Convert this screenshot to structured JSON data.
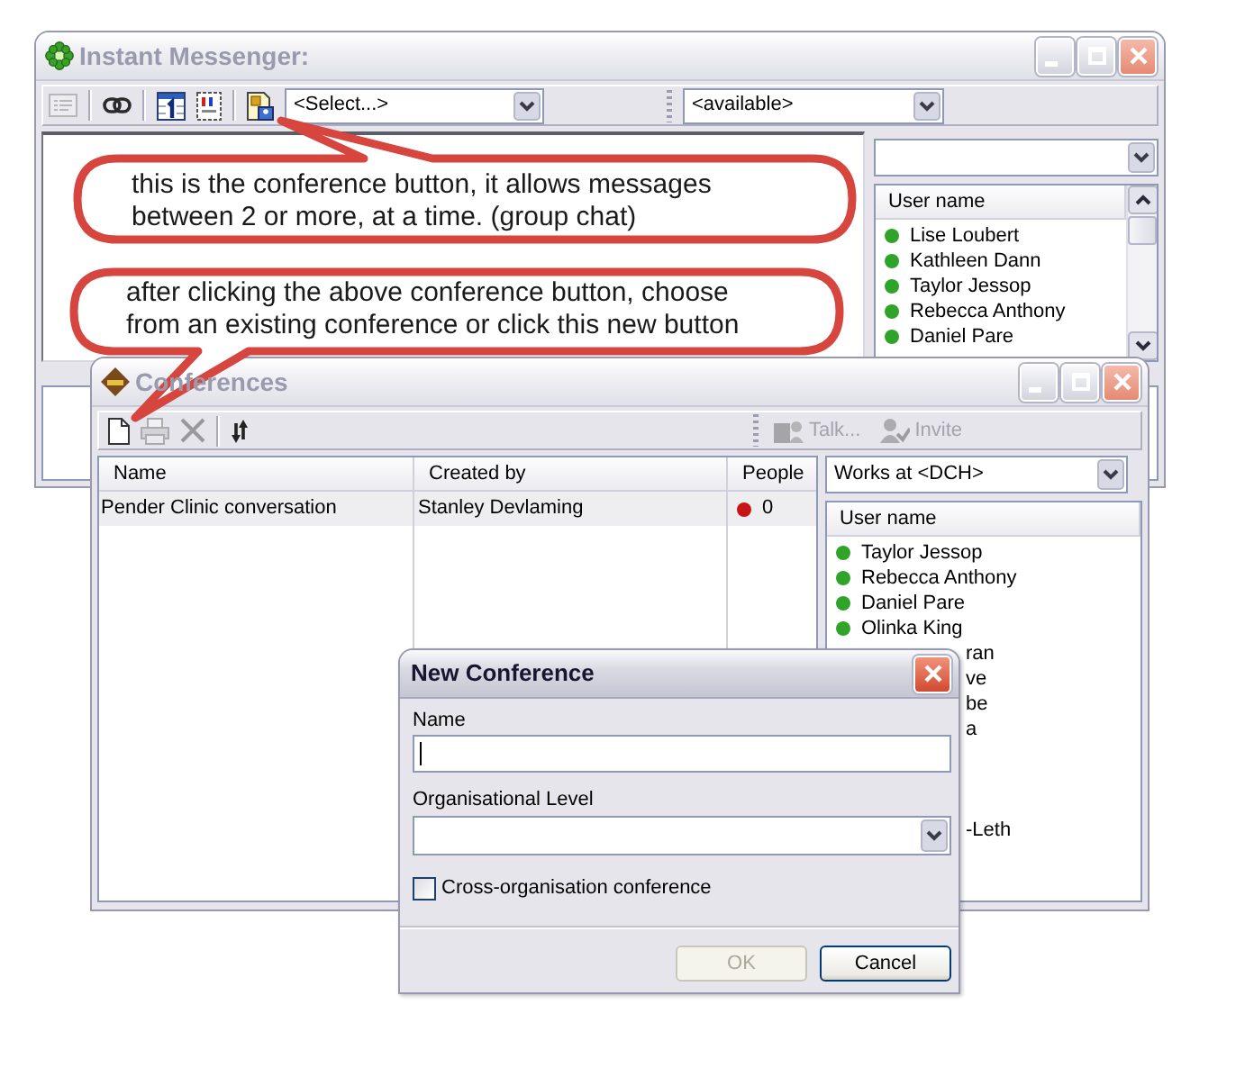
{
  "messenger_window": {
    "title": "Instant Messenger:",
    "active": false,
    "tools": [
      {
        "disabled": true
      },
      {
        "disabled": false
      },
      {
        "disabled": false
      },
      {
        "disabled": false
      },
      {
        "disabled": false
      }
    ],
    "contact_select": {
      "value": "<Select...>"
    },
    "status_select": {
      "value": "<available>"
    },
    "user_list": {
      "header": "User name",
      "users": [
        {
          "name": "Lise Loubert",
          "color": "#2fa32a"
        },
        {
          "name": "Kathleen Dann",
          "color": "#2fa32a"
        },
        {
          "name": "Taylor Jessop",
          "color": "#2fa32a"
        },
        {
          "name": "Rebecca Anthony",
          "color": "#2fa32a"
        },
        {
          "name": "Daniel Pare",
          "color": "#2fa32a"
        }
      ]
    }
  },
  "conferences_window": {
    "title": "Conferences",
    "active": false,
    "tools": [
      {
        "disabled": false
      },
      {
        "disabled": true
      },
      {
        "disabled": true
      },
      {
        "disabled": false
      }
    ],
    "actions": [
      {
        "label": "Talk...",
        "disabled": true
      },
      {
        "label": "Invite",
        "disabled": true
      }
    ],
    "table": {
      "columns": [
        "Name",
        "Created by",
        "People"
      ],
      "rows": [
        {
          "name": "Pender Clinic conversation",
          "created_by": "Stanley Devlaming",
          "people": "0",
          "color": "#c81414"
        }
      ]
    },
    "org_select": {
      "value": "Works at <DCH>"
    },
    "user_list": {
      "header": "User name",
      "users": [
        {
          "kind": "visible",
          "name": "Taylor Jessop",
          "color": "#2fa32a"
        },
        {
          "kind": "visible",
          "name": "Rebecca Anthony",
          "color": "#2fa32a"
        },
        {
          "kind": "visible",
          "name": "Daniel Pare",
          "color": "#2fa32a"
        },
        {
          "kind": "visible",
          "name": "Olinka King",
          "color": "#2fa32a"
        },
        {
          "kind": "covered",
          "name": "ran"
        },
        {
          "kind": "covered",
          "name": "ve"
        },
        {
          "kind": "covered",
          "name": "be"
        },
        {
          "kind": "covered",
          "name": "a"
        },
        {
          "kind": "covered",
          "name": "-Leth"
        }
      ]
    }
  },
  "callouts": [
    {
      "kind": "tail-up",
      "text": "this is the conference button, it allows messages\nbetween 2 or more, at a time. (group chat)"
    },
    {
      "kind": "tail-down",
      "text": "after clicking the above conference button, choose\nfrom an existing conference or click this new button"
    }
  ],
  "new_conference_dialog": {
    "title": "New Conference",
    "active": true,
    "name_field": {
      "label": "Name",
      "focused": true
    },
    "level_field": {
      "label": "Organisational Level"
    },
    "cross_org": {
      "label": "Cross-organisation conference",
      "checked": false
    },
    "buttons": [
      {
        "label": "OK",
        "disabled": true
      },
      {
        "label": "Cancel",
        "disabled": false
      }
    ]
  }
}
